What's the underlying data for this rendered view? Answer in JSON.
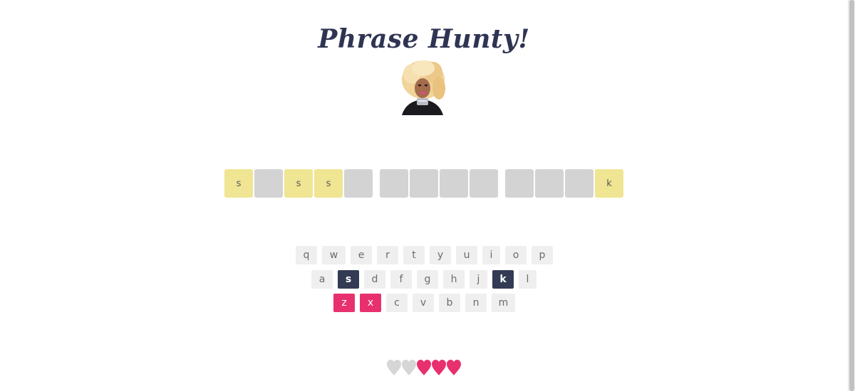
{
  "title": "Phrase Hunty!",
  "colors": {
    "revealed_tile": "#efe592",
    "hidden_tile": "#d3d3d3",
    "key_default": "#efefef",
    "key_correct": "#333a54",
    "key_wrong": "#e8306f",
    "heart_full": "#e8306f",
    "heart_lost": "#d6d6d6"
  },
  "phrase": {
    "words": [
      [
        "s",
        "",
        "s",
        "s",
        ""
      ],
      [
        "",
        "",
        "",
        ""
      ],
      [
        "",
        "",
        "",
        "k"
      ]
    ]
  },
  "keyboard": {
    "rows": [
      [
        {
          "label": "q",
          "state": "default"
        },
        {
          "label": "w",
          "state": "default"
        },
        {
          "label": "e",
          "state": "default"
        },
        {
          "label": "r",
          "state": "default"
        },
        {
          "label": "t",
          "state": "default"
        },
        {
          "label": "y",
          "state": "default"
        },
        {
          "label": "u",
          "state": "default"
        },
        {
          "label": "i",
          "state": "default"
        },
        {
          "label": "o",
          "state": "default"
        },
        {
          "label": "p",
          "state": "default"
        }
      ],
      [
        {
          "label": "a",
          "state": "default"
        },
        {
          "label": "s",
          "state": "correct"
        },
        {
          "label": "d",
          "state": "default"
        },
        {
          "label": "f",
          "state": "default"
        },
        {
          "label": "g",
          "state": "default"
        },
        {
          "label": "h",
          "state": "default"
        },
        {
          "label": "j",
          "state": "default"
        },
        {
          "label": "k",
          "state": "correct"
        },
        {
          "label": "l",
          "state": "default"
        }
      ],
      [
        {
          "label": "z",
          "state": "wrong"
        },
        {
          "label": "x",
          "state": "wrong"
        },
        {
          "label": "c",
          "state": "default"
        },
        {
          "label": "v",
          "state": "default"
        },
        {
          "label": "b",
          "state": "default"
        },
        {
          "label": "n",
          "state": "default"
        },
        {
          "label": "m",
          "state": "default"
        }
      ]
    ]
  },
  "lives": {
    "total": 5,
    "remaining": 3
  }
}
